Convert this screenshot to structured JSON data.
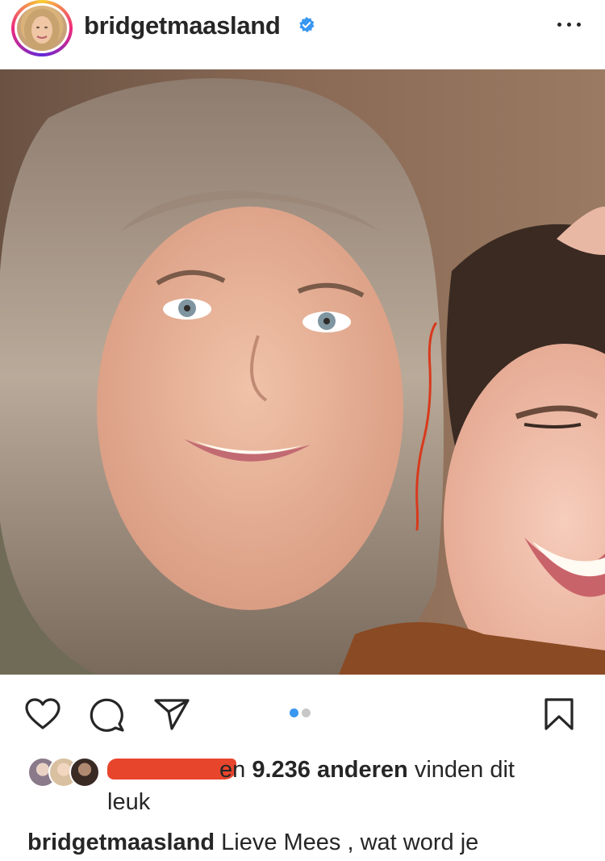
{
  "post": {
    "username": "bridgetmaasland",
    "verified_icon": "verified-badge-icon",
    "more_icon": "more-options-icon",
    "carousel": {
      "count": 2,
      "active_index": 0,
      "active_color": "#3897f0",
      "inactive_color": "#c7c7c7"
    }
  },
  "actions": {
    "like_icon": "heart-icon",
    "comment_icon": "comment-icon",
    "share_icon": "paper-plane-icon",
    "save_icon": "bookmark-icon"
  },
  "likes": {
    "prefix": "en",
    "count_text": "9.236 anderen",
    "suffix": "vinden dit",
    "line2": "leuk"
  },
  "caption": {
    "username": "bridgetmaasland",
    "text": "Lieve Mees , wat word je"
  },
  "colors": {
    "text": "#262626",
    "redaction": "#e8452d",
    "verified": "#3897f0"
  }
}
